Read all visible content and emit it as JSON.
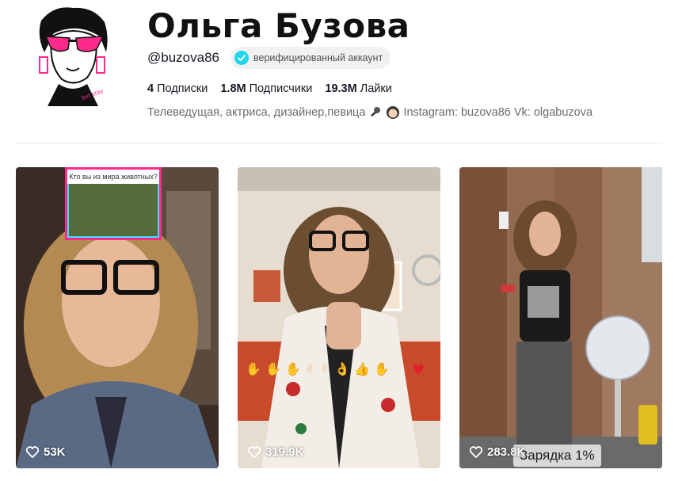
{
  "profile": {
    "name": "Ольга Бузова",
    "handle": "@buzova86",
    "verified_label": "верифицированный аккаунт",
    "stats": [
      {
        "value": "4",
        "label": "Подписки"
      },
      {
        "value": "1.8M",
        "label": "Подписчики"
      },
      {
        "value": "19.3M",
        "label": "Лайки"
      }
    ],
    "bio": "Телеведущая, актриса, дизайнер,певица",
    "bio_links": "Instagram: buzova86 Vk: olgabuzova"
  },
  "videos": [
    {
      "likes": "53K",
      "overlay_title": "Кто вы из мира животных?",
      "overlay_label": ""
    },
    {
      "likes": "319.9K",
      "overlay_title": "",
      "overlay_label": ""
    },
    {
      "likes": "283.8K",
      "overlay_title": "",
      "overlay_label": "Зарядка 1%"
    }
  ],
  "colors": {
    "verified": "#20d5ec",
    "accent_pink": "#ff2a8a"
  },
  "icons": {
    "verified": "check-badge-icon",
    "likes": "heart-outline-icon"
  }
}
